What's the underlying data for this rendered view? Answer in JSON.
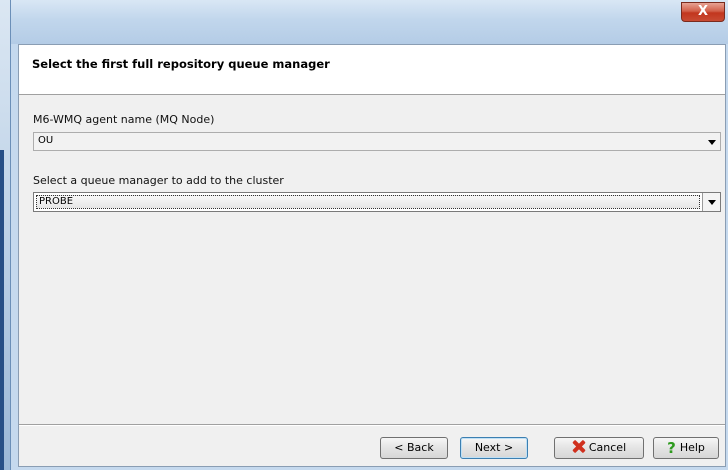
{
  "window": {
    "close_glyph": "X"
  },
  "header": {
    "title": "Select the first full repository queue manager"
  },
  "form": {
    "agent_label": "M6-WMQ agent name (MQ Node)",
    "agent_value": "OU",
    "qmgr_label": "Select a queue manager to add to the cluster",
    "qmgr_value": "PROBE"
  },
  "buttons": {
    "back": "< Back",
    "next": "Next >",
    "cancel": "Cancel",
    "help": "Help",
    "help_glyph": "?"
  },
  "icons": {
    "cancel": "red-x-icon",
    "help": "green-question-icon",
    "dropdown": "chevron-down-icon"
  },
  "colors": {
    "close_button": "#c2361e",
    "title_bar": "#c1d6ec",
    "cancel_icon": "#d0301e",
    "help_icon": "#2e9a1e",
    "default_button_border": "#3c7fb1"
  }
}
